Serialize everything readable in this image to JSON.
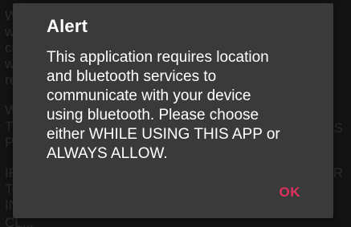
{
  "background": {
    "left_fragments": [
      "W",
      "w",
      "cl",
      "w",
      "re",
      "",
      "W",
      "TI",
      "PI",
      "",
      "IF",
      "To",
      "IN"
    ],
    "right_fragments": [
      "S",
      "R"
    ],
    "bottom_fragment": "CL..."
  },
  "dialog": {
    "title": "Alert",
    "message_lines": [
      "This application requires location",
      "and bluetooth services to",
      "communicate with your device",
      "using bluetooth. Please choose",
      "either WHILE USING THIS APP or",
      "ALWAYS ALLOW."
    ],
    "ok_label": "OK"
  },
  "colors": {
    "dialog_bg": "#3a3a3a",
    "accent": "#e0315e",
    "text": "#ffffff"
  }
}
